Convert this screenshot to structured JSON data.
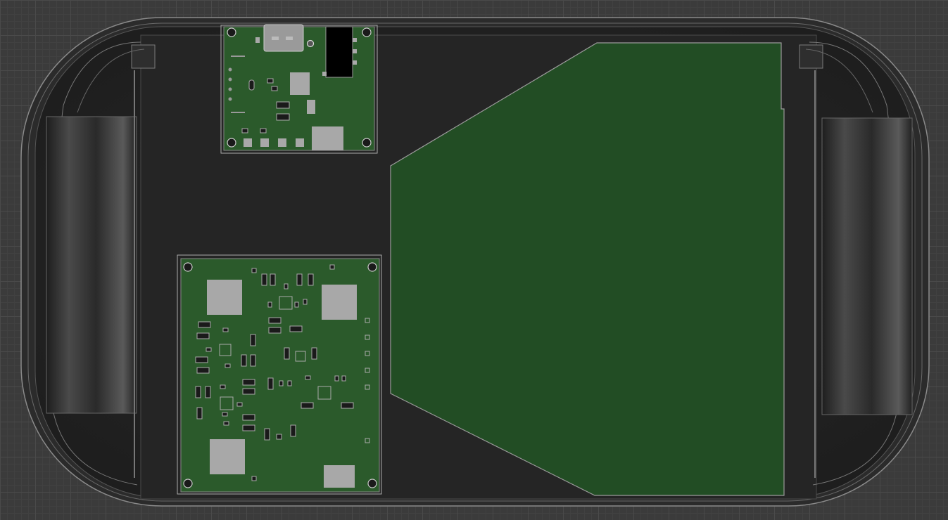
{
  "scene": {
    "description_objects": [
      "enclosure",
      "wireless-charging-coil",
      "usb-c-power-board",
      "main-controller-board",
      "left-handle",
      "right-handle"
    ]
  },
  "colors": {
    "background": "#3b3b3b",
    "grid_major": "#4a4a4a",
    "grid_minor": "#414141",
    "enclosure_body": "#232323",
    "enclosure_outline": "#9a9a9a",
    "pcb_green": "#2b5a2b",
    "coil_green": "#224d24",
    "pad_silver": "#a8a8a8",
    "component_dark": "#1a1a1a",
    "connector_black": "#000000"
  }
}
